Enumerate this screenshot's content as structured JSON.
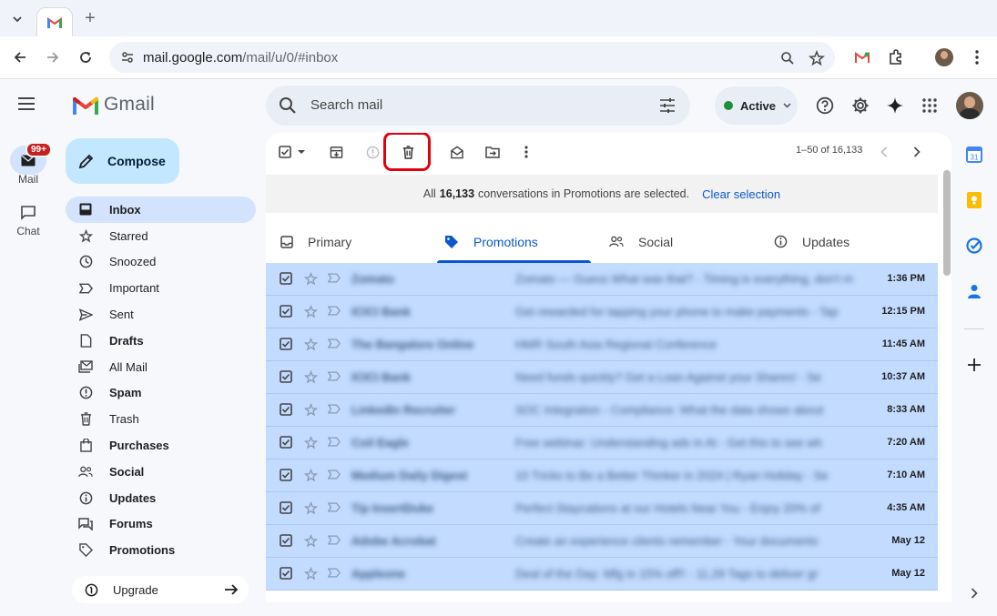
{
  "browser": {
    "url_host": "mail.google.com",
    "url_path": "/mail/u/0/#inbox"
  },
  "app": {
    "logo_text": "Gmail",
    "compose_label": "Compose",
    "rail": {
      "mail_label": "Mail",
      "mail_badge": "99+",
      "chat_label": "Chat"
    },
    "nav": [
      {
        "label": "Inbox",
        "icon": "inbox-icon"
      },
      {
        "label": "Starred",
        "icon": "star-icon"
      },
      {
        "label": "Snoozed",
        "icon": "clock-icon"
      },
      {
        "label": "Important",
        "icon": "important-icon"
      },
      {
        "label": "Sent",
        "icon": "send-icon"
      },
      {
        "label": "Drafts",
        "icon": "draft-icon"
      },
      {
        "label": "All Mail",
        "icon": "all-mail-icon"
      },
      {
        "label": "Spam",
        "icon": "spam-icon"
      },
      {
        "label": "Trash",
        "icon": "trash-icon"
      },
      {
        "label": "Purchases",
        "icon": "purchases-icon"
      },
      {
        "label": "Social",
        "icon": "social-icon"
      },
      {
        "label": "Updates",
        "icon": "updates-icon"
      },
      {
        "label": "Forums",
        "icon": "forums-icon"
      },
      {
        "label": "Promotions",
        "icon": "promotions-icon"
      }
    ],
    "upgrade_label": "Upgrade",
    "search_placeholder": "Search mail",
    "status_label": "Active",
    "pagination": "1–50 of 16,133",
    "selection": {
      "prefix": "All",
      "count": "16,133",
      "suffix": "conversations in Promotions are selected.",
      "clear_label": "Clear selection"
    },
    "tabs": [
      {
        "label": "Primary"
      },
      {
        "label": "Promotions"
      },
      {
        "label": "Social"
      },
      {
        "label": "Updates"
      }
    ],
    "emails": [
      {
        "sender": "Zomato",
        "subject": "Zomato — Guess What was that? - Timing is everything, don't miss our",
        "time": "1:36 PM"
      },
      {
        "sender": "ICICI Bank",
        "subject": "Get rewarded for tapping your phone to make payments - Tap",
        "time": "12:15 PM"
      },
      {
        "sender": "The Bangalore Online",
        "subject": "HMR South Asia Regional Conference",
        "time": "11:45 AM"
      },
      {
        "sender": "ICICI Bank",
        "subject": "Need funds quickly? Get a Loan Against your Shares! - Se",
        "time": "10:37 AM"
      },
      {
        "sender": "LinkedIn Recruiter",
        "subject": "SOC Integration - Compliance: What the data shows about",
        "time": "8:33 AM"
      },
      {
        "sender": "Coil Eagle",
        "subject": "Free webinar: Understanding ads in AI - Get this to see wh",
        "time": "7:20 AM"
      },
      {
        "sender": "Medium Daily Digest",
        "subject": "10 Tricks to Be a Better Thinker in 2024 | Ryan Holiday - Se",
        "time": "7:10 AM"
      },
      {
        "sender": "Tip InsertDuke",
        "subject": "Perfect Staycations at our Hotels Near You - Enjoy 20% of",
        "time": "4:35 AM"
      },
      {
        "sender": "Adobe Acrobat",
        "subject": "Create an experience clients remember - Your documents",
        "time": "May 12"
      },
      {
        "sender": "Appleone",
        "subject": "Deal of the Day: Mfg in 15% off!! - 11,29 Tags to deliver gr",
        "time": "May 12"
      }
    ]
  }
}
